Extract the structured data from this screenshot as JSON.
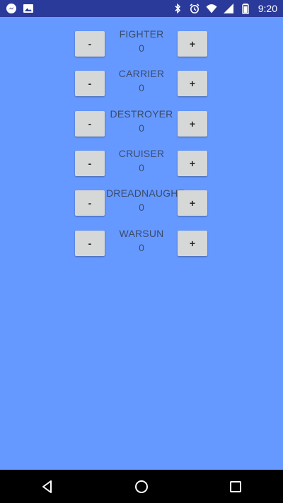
{
  "status_bar": {
    "time": "9:20",
    "left_icons": [
      "messenger-icon",
      "image-icon"
    ],
    "right_icons": [
      "bluetooth-icon",
      "alarm-icon",
      "wifi-icon",
      "signal-icon",
      "battery-icon"
    ]
  },
  "units": [
    {
      "name": "FIGHTER",
      "count": "0",
      "minus_label": "-",
      "plus_label": "+"
    },
    {
      "name": "CARRIER",
      "count": "0",
      "minus_label": "-",
      "plus_label": "+"
    },
    {
      "name": "DESTROYER",
      "count": "0",
      "minus_label": "-",
      "plus_label": "+"
    },
    {
      "name": "CRUISER",
      "count": "0",
      "minus_label": "-",
      "plus_label": "+"
    },
    {
      "name": "DREADNAUGHT",
      "count": "0",
      "minus_label": "-",
      "plus_label": "+"
    },
    {
      "name": "WARSUN",
      "count": "0",
      "minus_label": "-",
      "plus_label": "+"
    }
  ],
  "nav_bar": {
    "icons": [
      "back-icon",
      "home-icon",
      "recents-icon"
    ]
  },
  "colors": {
    "background": "#6699ff",
    "status_bar": "#2a3a9a",
    "button": "#d6d7d7",
    "label_text": "#3b4b6b",
    "nav_bar": "#000000"
  }
}
